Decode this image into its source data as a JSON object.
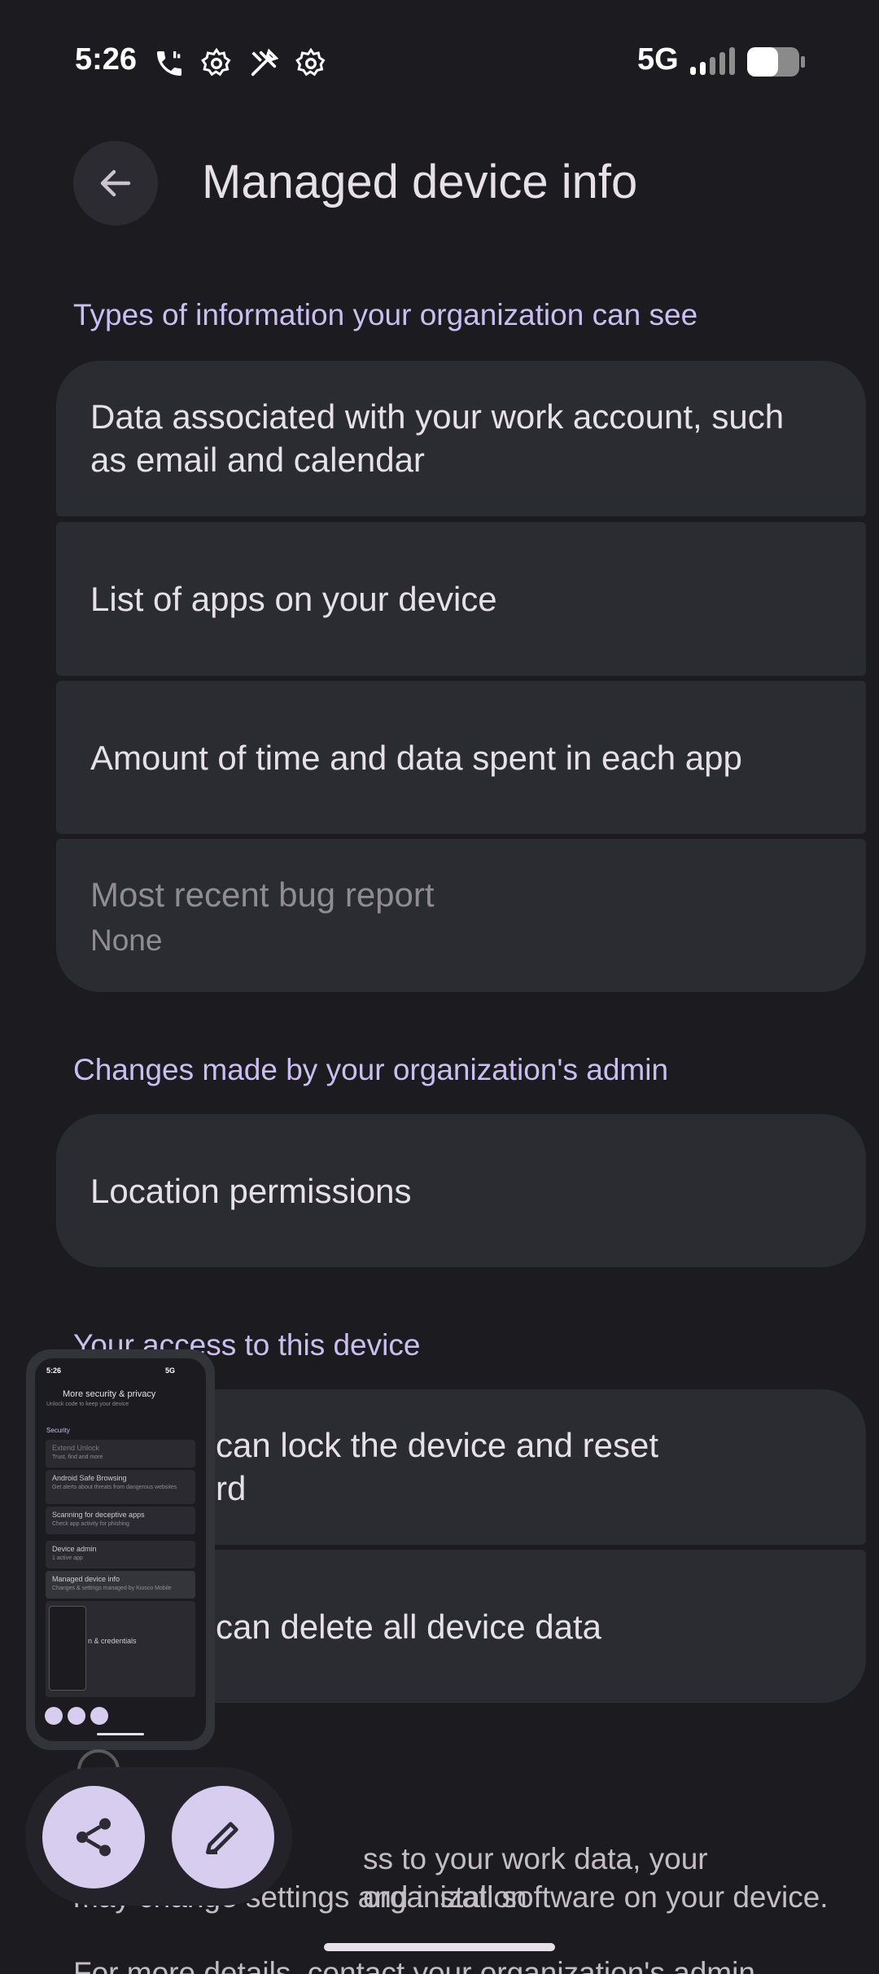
{
  "status_bar": {
    "time": "5:26",
    "network": "5G",
    "icons": [
      "call-icon",
      "gear-icon",
      "tools-icon",
      "gear-icon",
      "signal-icon",
      "battery-icon"
    ]
  },
  "header": {
    "title": "Managed device info",
    "back_icon": "arrow-back-icon"
  },
  "sections": {
    "info_types": {
      "title": "Types of information your organization can see",
      "items": [
        {
          "label": "Data associated with your work account, such as email and calendar"
        },
        {
          "label": "List of apps on your device"
        },
        {
          "label": "Amount of time and data spent in each app"
        },
        {
          "label": "Most recent bug report",
          "value": "None"
        }
      ]
    },
    "admin_changes": {
      "title": "Changes made by your organization's admin",
      "items": [
        {
          "label": "Location permissions"
        }
      ]
    },
    "access": {
      "title": "Your access to this device",
      "items": [
        {
          "label": "can lock the device and reset",
          "label_line2": "rd"
        },
        {
          "label": "can delete all device data"
        }
      ]
    }
  },
  "footer": {
    "line1": "ss to your work data, your organization",
    "line2": "may change settings and install software on your device.",
    "line3": "For more details, contact your organization's admin."
  },
  "preview": {
    "time": "5:26",
    "network": "5G",
    "title": "More security & privacy",
    "subtitle_top": "Unlock code to keep your device",
    "section": "Security",
    "rows": [
      {
        "title": "Extend Unlock",
        "sub": "Trust, find and more"
      },
      {
        "title": "Android Safe Browsing",
        "sub": "Get alerts about threats from dangerous websites"
      },
      {
        "title": "Scanning for deceptive apps",
        "sub": "Check app activity for phishing"
      },
      {
        "title": "Device admin",
        "sub": "1 active app"
      },
      {
        "title": "Managed device info",
        "sub": "Changes & settings managed by Kiosco Mobile"
      }
    ],
    "partial_row": "n & credentials"
  },
  "screenshot_actions": {
    "share_icon": "share-icon",
    "edit_icon": "edit-pencil-icon"
  },
  "colors": {
    "background": "#1b1b20",
    "card": "#2b2b32",
    "accent": "#c9bff1",
    "fab": "#d6cdef"
  }
}
